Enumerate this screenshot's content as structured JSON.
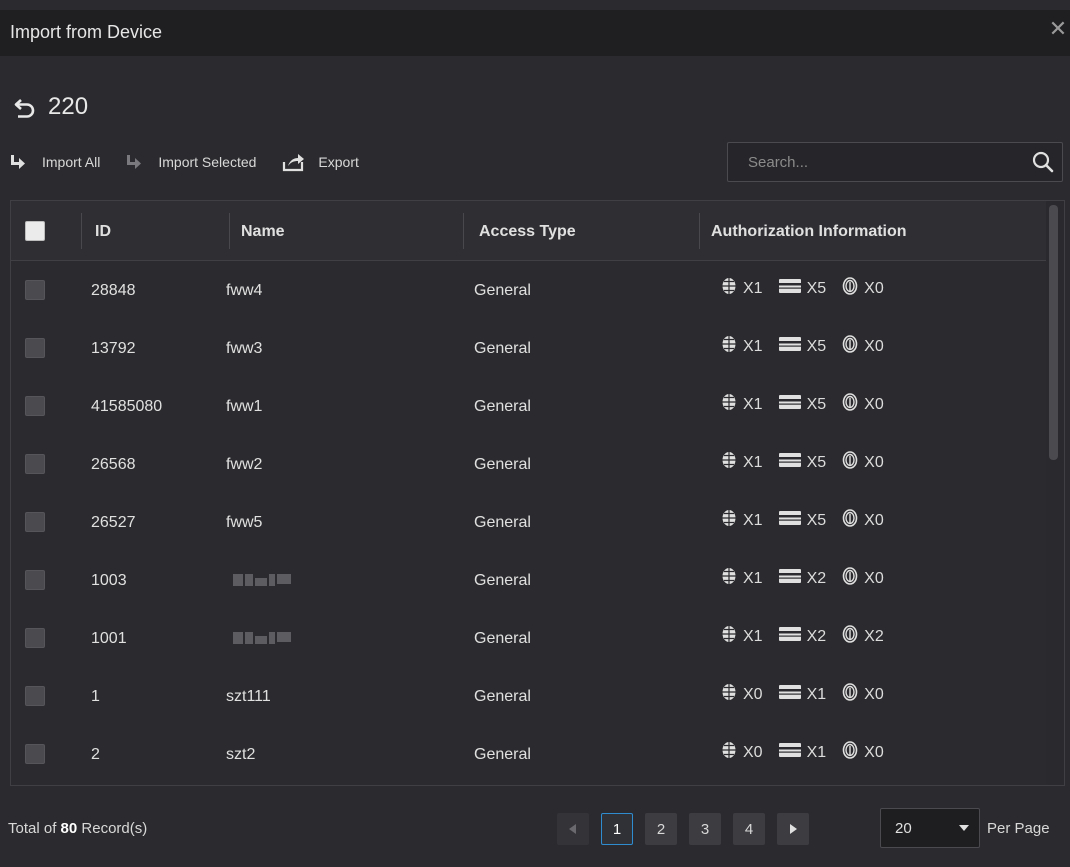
{
  "dialog": {
    "title": "Import from Device",
    "close_icon": "close-icon"
  },
  "header": {
    "back_icon": "back-arrow-icon",
    "title": "220"
  },
  "toolbar": {
    "import_all": "Import All",
    "import_selected": "Import Selected",
    "export": "Export"
  },
  "search": {
    "placeholder": "Search...",
    "value": ""
  },
  "table": {
    "columns": [
      "ID",
      "Name",
      "Access Type",
      "Authorization Information"
    ],
    "rows": [
      {
        "id": "28848",
        "name": "fww4",
        "type": "General",
        "face": "X1",
        "card": "X5",
        "finger": "X0"
      },
      {
        "id": "13792",
        "name": "fww3",
        "type": "General",
        "face": "X1",
        "card": "X5",
        "finger": "X0"
      },
      {
        "id": "41585080",
        "name": "fww1",
        "type": "General",
        "face": "X1",
        "card": "X5",
        "finger": "X0"
      },
      {
        "id": "26568",
        "name": "fww2",
        "type": "General",
        "face": "X1",
        "card": "X5",
        "finger": "X0"
      },
      {
        "id": "26527",
        "name": "fww5",
        "type": "General",
        "face": "X1",
        "card": "X5",
        "finger": "X0"
      },
      {
        "id": "1003",
        "name": "",
        "type": "General",
        "face": "X1",
        "card": "X2",
        "finger": "X0"
      },
      {
        "id": "1001",
        "name": "",
        "type": "General",
        "face": "X1",
        "card": "X2",
        "finger": "X2"
      },
      {
        "id": "1",
        "name": "szt111",
        "type": "General",
        "face": "X0",
        "card": "X1",
        "finger": "X0"
      },
      {
        "id": "2",
        "name": "szt2",
        "type": "General",
        "face": "X0",
        "card": "X1",
        "finger": "X0"
      }
    ]
  },
  "footer": {
    "total_prefix": "Total of",
    "total_count": "80",
    "total_suffix": "Record(s)",
    "pages": [
      "1",
      "2",
      "3",
      "4"
    ],
    "active_page": "1",
    "per_page_value": "20",
    "per_page_label": "Per Page"
  },
  "colors": {
    "accent": "#2f8ccf",
    "background": "#2b2b2f",
    "titlebar": "#1f1f22"
  }
}
